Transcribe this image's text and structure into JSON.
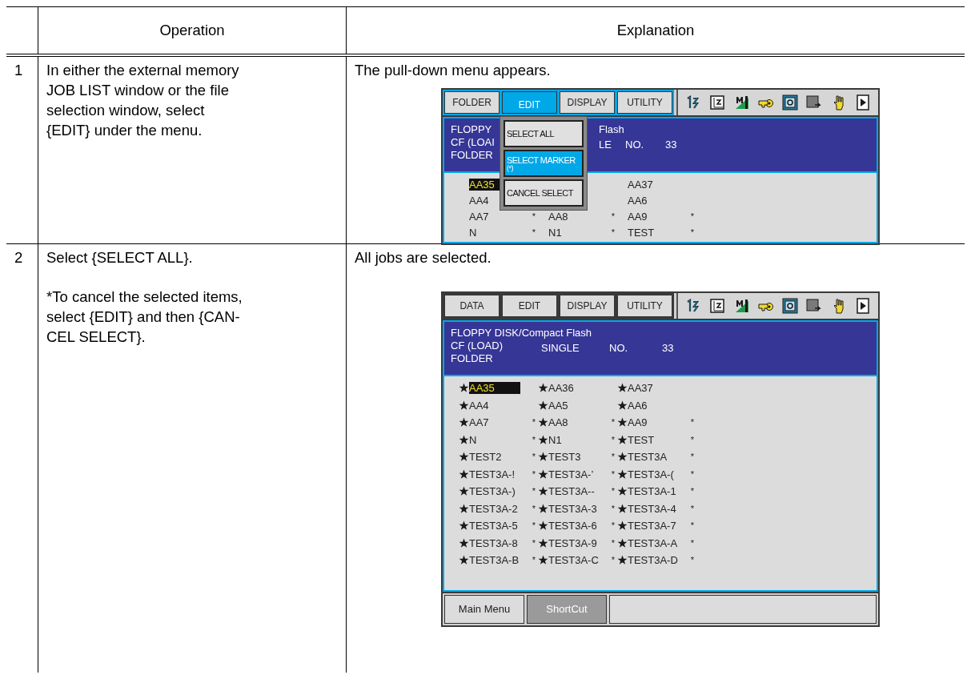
{
  "table": {
    "columns": [
      "Operation",
      "Explanation"
    ],
    "rows": [
      {
        "number": "1",
        "operation": [
          "In either the external memory\nJOB LIST window or the file\nselection window, select\n{EDIT} under the menu."
        ],
        "explanation": "The pull-down menu appears.",
        "screen": {
          "kind": "with_menu",
          "menus": [
            {
              "label": "FOLDER",
              "selected": false
            },
            {
              "label": "EDIT",
              "selected": true
            },
            {
              "label": "DISPLAY",
              "selected": false
            },
            {
              "label": "UTILITY",
              "selected": false
            }
          ],
          "header": [
            {
              "column_1": "FLOPPY",
              "column_2": "Flash"
            },
            {
              "column_1": "CF (LOAI",
              "column_2": "LE",
              "column_3": "NO.",
              "column_4": "33"
            },
            {
              "column_1": "FOLDER"
            }
          ],
          "pulldown": [
            {
              "label": "SELECT ALL",
              "selected": false
            },
            {
              "label": "SELECT MARKER",
              "sublabel": "(*)",
              "selected": true
            },
            {
              "label": "CANCEL SELECT",
              "selected": false
            }
          ],
          "files": [
            {
              "column_1": {
                "name": "AA35",
                "starred": false,
                "cursor": true
              },
              "column_3": {
                "name": "AA37",
                "starred": false,
                "cursor": false
              }
            },
            {
              "column_1": {
                "name": "AA4",
                "starred": false,
                "cursor": false
              },
              "column_3": {
                "name": "AA6",
                "starred": false,
                "cursor": false
              }
            },
            {
              "column_1": {
                "name": "AA7",
                "marker": "*",
                "starred": false,
                "cursor": false
              },
              "column_2": {
                "name": "AA8",
                "marker": "*",
                "starred": false,
                "cursor": false
              },
              "column_3": {
                "name": "AA9",
                "marker": "*",
                "starred": false,
                "cursor": false
              }
            },
            {
              "column_1": {
                "name": "N",
                "marker": "*",
                "starred": false,
                "cursor": false
              },
              "column_2": {
                "name": "N1",
                "marker": "*",
                "starred": false,
                "cursor": false
              },
              "column_3": {
                "name": "TEST",
                "marker": "*",
                "starred": false,
                "cursor": false
              }
            }
          ]
        }
      },
      {
        "number": "2",
        "operation": [
          "Select {SELECT ALL}.",
          "*To cancel the selected items,\nselect {EDIT} and then {CAN-\nCEL SELECT}."
        ],
        "explanation": "All jobs are selected.",
        "screen": {
          "kind": "full",
          "menus": [
            {
              "label": "DATA",
              "selected": false
            },
            {
              "label": "EDIT",
              "selected": false
            },
            {
              "label": "DISPLAY",
              "selected": false
            },
            {
              "label": "UTILITY",
              "selected": false
            }
          ],
          "header": [
            {
              "column_1": "FLOPPY DISK/Compact Flash"
            },
            {
              "column_1": "CF (LOAD)",
              "column_2": "SINGLE",
              "column_3": "NO.",
              "column_4": "33"
            },
            {
              "column_1": "FOLDER"
            }
          ],
          "files": [
            {
              "column_1": {
                "name": "AA35",
                "starred": true,
                "cursor": true
              },
              "column_2": {
                "name": "AA36",
                "starred": true,
                "cursor": false
              },
              "column_3": {
                "name": "AA37",
                "starred": true,
                "cursor": false
              }
            },
            {
              "column_1": {
                "name": "AA4",
                "starred": true,
                "cursor": false
              },
              "column_2": {
                "name": "AA5",
                "starred": true,
                "cursor": false
              },
              "column_3": {
                "name": "AA6",
                "starred": true,
                "cursor": false
              }
            },
            {
              "column_1": {
                "name": "AA7",
                "marker": "*",
                "starred": true,
                "cursor": false
              },
              "column_2": {
                "name": "AA8",
                "marker": "*",
                "starred": true,
                "cursor": false
              },
              "column_3": {
                "name": "AA9",
                "marker": "*",
                "starred": true,
                "cursor": false
              }
            },
            {
              "column_1": {
                "name": "N",
                "marker": "*",
                "starred": true,
                "cursor": false
              },
              "column_2": {
                "name": "N1",
                "marker": "*",
                "starred": true,
                "cursor": false
              },
              "column_3": {
                "name": "TEST",
                "marker": "*",
                "starred": true,
                "cursor": false
              }
            },
            {
              "column_1": {
                "name": "TEST2",
                "marker": "*",
                "starred": true,
                "cursor": false
              },
              "column_2": {
                "name": "TEST3",
                "marker": "*",
                "starred": true,
                "cursor": false
              },
              "column_3": {
                "name": "TEST3A",
                "marker": "*",
                "starred": true,
                "cursor": false
              }
            },
            {
              "column_1": {
                "name": "TEST3A-!",
                "marker": "*",
                "starred": true,
                "cursor": false
              },
              "column_2": {
                "name": "TEST3A-’",
                "marker": "*",
                "starred": true,
                "cursor": false
              },
              "column_3": {
                "name": "TEST3A-(",
                "marker": "*",
                "starred": true,
                "cursor": false
              }
            },
            {
              "column_1": {
                "name": "TEST3A-)",
                "marker": "*",
                "starred": true,
                "cursor": false
              },
              "column_2": {
                "name": "TEST3A--",
                "marker": "*",
                "starred": true,
                "cursor": false
              },
              "column_3": {
                "name": "TEST3A-1",
                "marker": "*",
                "starred": true,
                "cursor": false
              }
            },
            {
              "column_1": {
                "name": "TEST3A-2",
                "marker": "*",
                "starred": true,
                "cursor": false
              },
              "column_2": {
                "name": "TEST3A-3",
                "marker": "*",
                "starred": true,
                "cursor": false
              },
              "column_3": {
                "name": "TEST3A-4",
                "marker": "*",
                "starred": true,
                "cursor": false
              }
            },
            {
              "column_1": {
                "name": "TEST3A-5",
                "marker": "*",
                "starred": true,
                "cursor": false
              },
              "column_2": {
                "name": "TEST3A-6",
                "marker": "*",
                "starred": true,
                "cursor": false
              },
              "column_3": {
                "name": "TEST3A-7",
                "marker": "*",
                "starred": true,
                "cursor": false
              }
            },
            {
              "column_1": {
                "name": "TEST3A-8",
                "marker": "*",
                "starred": true,
                "cursor": false
              },
              "column_2": {
                "name": "TEST3A-9",
                "marker": "*",
                "starred": true,
                "cursor": false
              },
              "column_3": {
                "name": "TEST3A-A",
                "marker": "*",
                "starred": true,
                "cursor": false
              }
            },
            {
              "column_1": {
                "name": "TEST3A-B",
                "marker": "*",
                "starred": true,
                "cursor": false
              },
              "column_2": {
                "name": "TEST3A-C",
                "marker": "*",
                "starred": true,
                "cursor": false
              },
              "column_3": {
                "name": "TEST3A-D",
                "marker": "*",
                "starred": true,
                "cursor": false
              }
            }
          ],
          "bottom_bar": [
            {
              "label": "Main Menu",
              "disabled": false
            },
            {
              "label": "ShortCut",
              "disabled": true
            }
          ]
        }
      }
    ]
  }
}
